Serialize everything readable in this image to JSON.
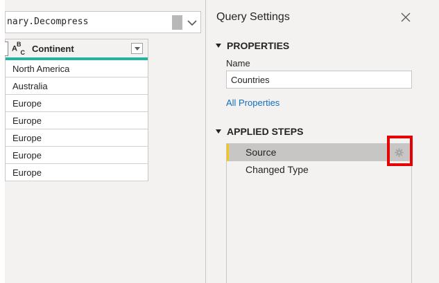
{
  "formula_bar": {
    "text": "nary.Decompress"
  },
  "table": {
    "column_header": "Continent",
    "column_type_icon": "text-type-icon",
    "rows": [
      "North America",
      "Australia",
      "Europe",
      "Europe",
      "Europe",
      "Europe",
      "Europe"
    ]
  },
  "settings": {
    "title": "Query Settings",
    "properties_header": "PROPERTIES",
    "name_label": "Name",
    "name_value": "Countries",
    "all_properties_link": "All Properties",
    "applied_steps_header": "APPLIED STEPS",
    "steps": [
      {
        "label": "Source",
        "selected": true,
        "has_gear": true
      },
      {
        "label": "Changed Type",
        "selected": false,
        "has_gear": false
      }
    ]
  },
  "colors": {
    "quality_bar": "#1fb5a3",
    "selected_step_accent": "#f2c811",
    "highlight": "#e60000",
    "link": "#106ebe"
  }
}
